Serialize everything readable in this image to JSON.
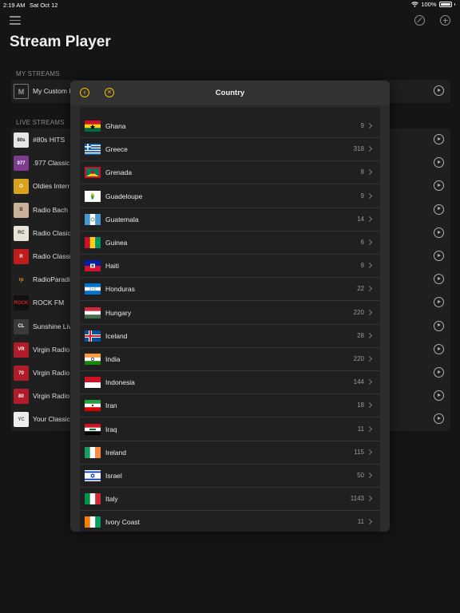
{
  "status": {
    "time": "2:19 AM",
    "date": "Sat Oct 12",
    "battery": "100%"
  },
  "app": {
    "title": "Stream Player"
  },
  "sections": {
    "my_streams": "MY STREAMS",
    "live_streams": "LIVE STREAMS"
  },
  "my_streams": [
    {
      "name": "My Custom I",
      "logo_text": "M"
    }
  ],
  "live_streams": [
    {
      "name": "#80s HITS",
      "logo_text": "80s",
      "logo_bg": "#e6e6e6",
      "logo_fg": "#222"
    },
    {
      "name": ".977 Classic",
      "logo_text": "977",
      "logo_bg": "#7d3c8e",
      "logo_fg": "#fff"
    },
    {
      "name": "Oldies Interr",
      "logo_text": "O",
      "logo_bg": "#d9a21b",
      "logo_fg": "#fff"
    },
    {
      "name": "Radio Bach",
      "logo_text": "B",
      "logo_bg": "#c8b29a",
      "logo_fg": "#533"
    },
    {
      "name": "Radio Clasic",
      "logo_text": "RC",
      "logo_bg": "#e9e4d6",
      "logo_fg": "#444"
    },
    {
      "name": "Radio Classi",
      "logo_text": "R",
      "logo_bg": "#c21b1b",
      "logo_fg": "#fff"
    },
    {
      "name": "RadioParadis",
      "logo_text": "rp",
      "logo_bg": "#1f1f1f",
      "logo_fg": "#e0931b"
    },
    {
      "name": "ROCK FM",
      "logo_text": "ROCK",
      "logo_bg": "#111111",
      "logo_fg": "#d92020"
    },
    {
      "name": "Sunshine Liv",
      "logo_text": "CL",
      "logo_bg": "#3a3a3a",
      "logo_fg": "#fff"
    },
    {
      "name": "Virgin Radio",
      "logo_text": "VR",
      "logo_bg": "#b11c2a",
      "logo_fg": "#fff"
    },
    {
      "name": "Virgin Radio",
      "logo_text": "70",
      "logo_bg": "#b11c2a",
      "logo_fg": "#fff"
    },
    {
      "name": "Virgin Radio",
      "logo_text": "80",
      "logo_bg": "#b11c2a",
      "logo_fg": "#fff"
    },
    {
      "name": "Your Classic",
      "logo_text": "YC",
      "logo_bg": "#eeeeee",
      "logo_fg": "#555"
    }
  ],
  "modal": {
    "title": "Country",
    "back_icon": "chevron-left-circle-icon",
    "close_icon": "close-circle-icon"
  },
  "countries": [
    {
      "name": "Ghana",
      "count": "9",
      "flag": "gh"
    },
    {
      "name": "Greece",
      "count": "318",
      "flag": "gr"
    },
    {
      "name": "Grenada",
      "count": "8",
      "flag": "gd"
    },
    {
      "name": "Guadeloupe",
      "count": "9",
      "flag": "gp"
    },
    {
      "name": "Guatemala",
      "count": "14",
      "flag": "gt"
    },
    {
      "name": "Guinea",
      "count": "6",
      "flag": "gn"
    },
    {
      "name": "Haiti",
      "count": "9",
      "flag": "ht"
    },
    {
      "name": "Honduras",
      "count": "22",
      "flag": "hn"
    },
    {
      "name": "Hungary",
      "count": "220",
      "flag": "hu"
    },
    {
      "name": "Iceland",
      "count": "28",
      "flag": "is"
    },
    {
      "name": "India",
      "count": "220",
      "flag": "in"
    },
    {
      "name": "Indonesia",
      "count": "144",
      "flag": "id"
    },
    {
      "name": "Iran",
      "count": "18",
      "flag": "ir"
    },
    {
      "name": "Iraq",
      "count": "11",
      "flag": "iq"
    },
    {
      "name": "Ireland",
      "count": "115",
      "flag": "ie"
    },
    {
      "name": "Israel",
      "count": "50",
      "flag": "il"
    },
    {
      "name": "Italy",
      "count": "1143",
      "flag": "it"
    },
    {
      "name": "Ivory Coast",
      "count": "11",
      "flag": "ci"
    }
  ],
  "colors": {
    "accent": "#f2c200",
    "background": "#151515",
    "modal": "#2c2c2c"
  }
}
